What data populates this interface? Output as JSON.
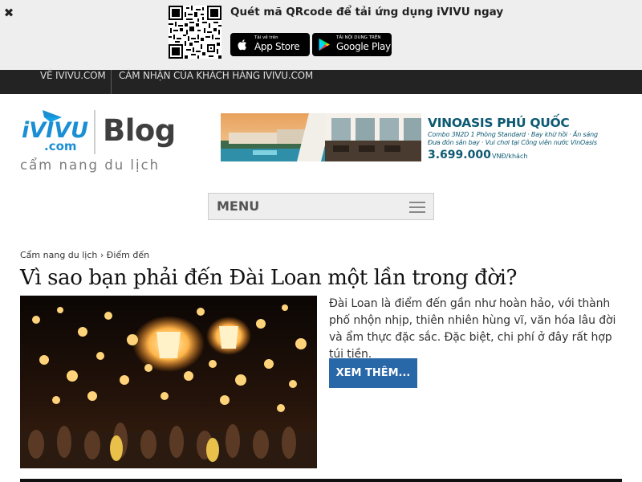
{
  "app_banner": {
    "close_glyph": "✖",
    "message": "Quét mã QRcode để tải ứng dụng iVIVU ngay",
    "app_store": {
      "small": "Tải về trên",
      "big": "App Store"
    },
    "google_play": {
      "small": "TẢI NỘI DUNG TRÊN",
      "big": "Google Play"
    }
  },
  "topnav": {
    "items": [
      "VỀ IVIVU.COM",
      "CẢM NHẬN CỦA KHÁCH HÀNG IVIVU.COM"
    ]
  },
  "header": {
    "logo_text": "iVIVU",
    "logo_domain": ".com",
    "blog_word": "Blog",
    "tagline": "cẩm nang du lịch"
  },
  "ad": {
    "title": "VINOASIS PHÚ QUỐC",
    "line1": "Combo 3N2D 1 Phòng Standard · Bay khứ hồi · Ăn sáng",
    "line2": "Đưa đón sân bay · Vui chơi tại Công viên nước VinOasis",
    "price": "3.699.000",
    "unit": "VNĐ/khách"
  },
  "menu": {
    "label": "MENU"
  },
  "breadcrumb": {
    "home": "Cẩm nang du lịch",
    "separator": "›",
    "current": "Điểm đến"
  },
  "article": {
    "title": "Vì sao bạn phải đến Đài Loan một lần trong đời?",
    "excerpt": "Đài Loan là điểm đến gần như hoàn hảo, với thành phố nhộn nhịp, thiên nhiên hùng vĩ, văn hóa lâu đời và ẩm thực đặc sắc. Đặc biệt, chi phí ở đây rất hợp túi tiền.",
    "read_more": "XEM THÊM..."
  },
  "colors": {
    "banner_bg": "#eeeeee",
    "nav_bg": "#232323",
    "accent_blue": "#2867a8",
    "logo_blue": "#1b8fd3"
  }
}
